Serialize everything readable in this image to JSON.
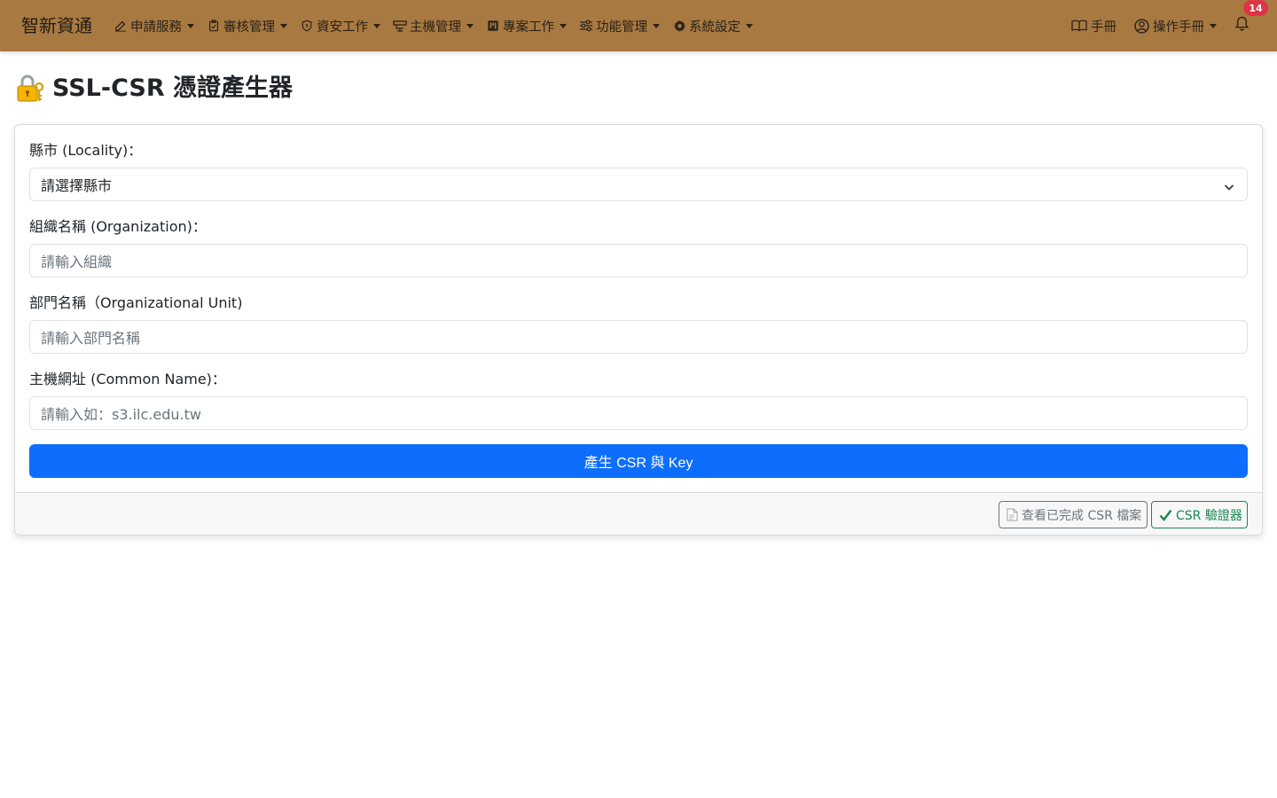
{
  "navbar": {
    "brand": "智新資通",
    "menu": [
      {
        "label": "申請服務",
        "icon": "edit-icon"
      },
      {
        "label": "審核管理",
        "icon": "clipboard-check-icon"
      },
      {
        "label": "資安工作",
        "icon": "shield-icon"
      },
      {
        "label": "主機管理",
        "icon": "server-icon"
      },
      {
        "label": "專案工作",
        "icon": "kanban-icon"
      },
      {
        "label": "功能管理",
        "icon": "sliders-icon"
      },
      {
        "label": "系統設定",
        "icon": "gear-icon"
      }
    ],
    "manual_label": "手冊",
    "user_label": "操作手冊",
    "notification_count": "14"
  },
  "page": {
    "title": "SSL-CSR 憑證產生器"
  },
  "form": {
    "locality_label": "縣市 (Locality)：",
    "locality_value": "請選擇縣市",
    "organization_label": "組織名稱 (Organization)：",
    "organization_placeholder": "請輸入組織",
    "unit_label": "部門名稱（Organizational Unit)",
    "unit_placeholder": "請輸入部門名稱",
    "common_name_label": "主機網址 (Common Name)：",
    "common_name_placeholder": "請輸入如：s3.ilc.edu.tw",
    "submit_label": "產生 CSR 與 Key"
  },
  "footer": {
    "view_files_label": "查看已完成 CSR 檔案",
    "validator_label": "CSR 驗證器"
  },
  "colors": {
    "navbar": "#a87941",
    "primary": "#0d6efd",
    "success": "#198754",
    "danger": "#dc3545"
  }
}
